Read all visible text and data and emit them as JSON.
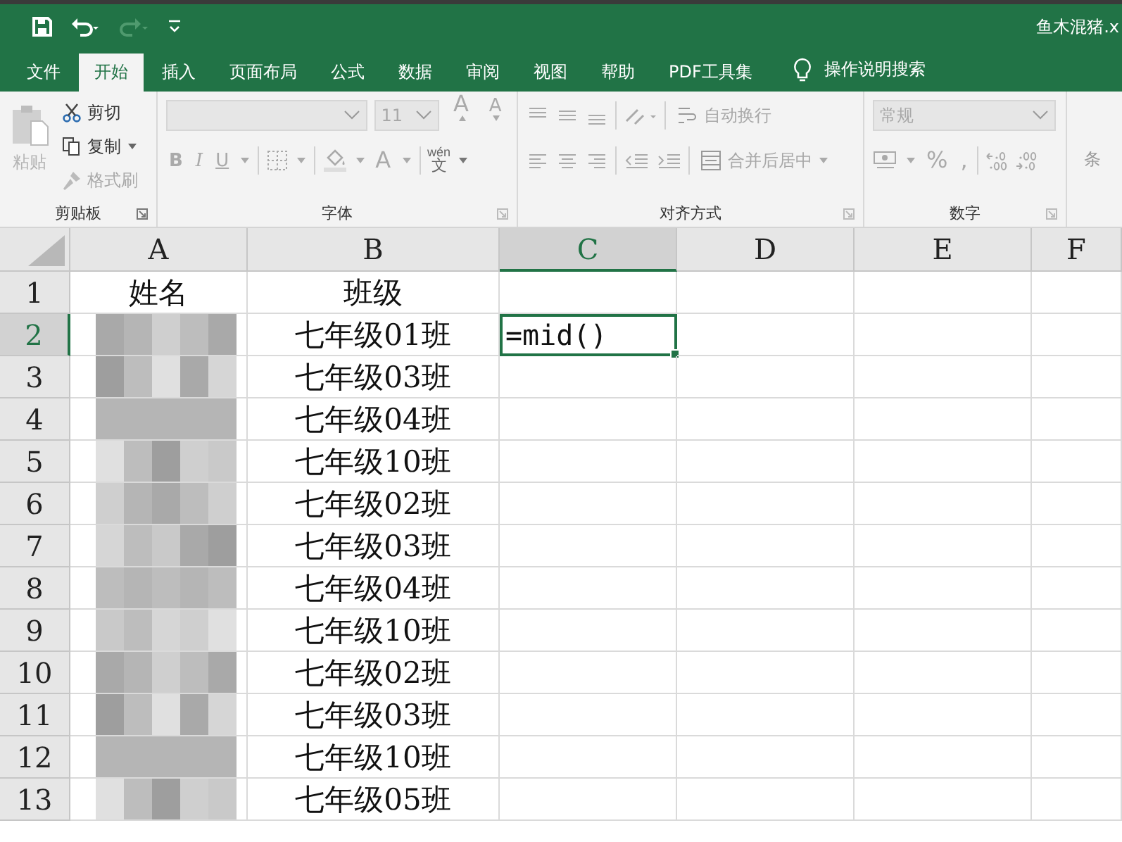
{
  "window": {
    "title": "鱼木混猪.x"
  },
  "tabs": [
    {
      "label": "文件",
      "selected": false
    },
    {
      "label": "开始",
      "selected": true
    },
    {
      "label": "插入",
      "selected": false
    },
    {
      "label": "页面布局",
      "selected": false
    },
    {
      "label": "公式",
      "selected": false
    },
    {
      "label": "数据",
      "selected": false
    },
    {
      "label": "审阅",
      "selected": false
    },
    {
      "label": "视图",
      "selected": false
    },
    {
      "label": "帮助",
      "selected": false
    },
    {
      "label": "PDF工具集",
      "selected": false
    }
  ],
  "tell_me": {
    "placeholder": "操作说明搜索"
  },
  "ribbon": {
    "clipboard": {
      "title": "剪贴板",
      "paste": {
        "label": "粘贴",
        "disabled": true
      },
      "cut": {
        "label": "剪切",
        "disabled": false
      },
      "copy": {
        "label": "复制",
        "disabled": false
      },
      "format_painter": {
        "label": "格式刷",
        "disabled": true
      }
    },
    "font": {
      "title": "字体",
      "font_size": {
        "value": "11"
      },
      "grow": "A",
      "shrink": "A",
      "bold": "B",
      "italic": "I",
      "underline": "U",
      "font_color": "A",
      "phonetic_top": "wén",
      "phonetic_bottom": "文"
    },
    "alignment": {
      "title": "对齐方式",
      "wrap_text": "自动换行",
      "merge_center": "合并后居中"
    },
    "number": {
      "title": "数字",
      "format": {
        "value": "常规"
      },
      "percent": "%",
      "comma": ","
    },
    "cut_off_group_label": "条"
  },
  "sheet": {
    "columns": [
      {
        "label": "A",
        "selected": false
      },
      {
        "label": "B",
        "selected": false
      },
      {
        "label": "C",
        "selected": true
      },
      {
        "label": "D",
        "selected": false
      },
      {
        "label": "E",
        "selected": false
      },
      {
        "label": "F",
        "selected": false
      }
    ],
    "rows": [
      {
        "number": "1",
        "selected": false,
        "name_pixelated": false,
        "name": "姓名",
        "class": "班级"
      },
      {
        "number": "2",
        "selected": true,
        "name_pixelated": true,
        "class": "七年级01班",
        "c": "=mid()"
      },
      {
        "number": "3",
        "selected": false,
        "name_pixelated": true,
        "class": "七年级03班"
      },
      {
        "number": "4",
        "selected": false,
        "name_pixelated": true,
        "class": "七年级04班"
      },
      {
        "number": "5",
        "selected": false,
        "name_pixelated": true,
        "class": "七年级10班"
      },
      {
        "number": "6",
        "selected": false,
        "name_pixelated": true,
        "class": "七年级02班"
      },
      {
        "number": "7",
        "selected": false,
        "name_pixelated": true,
        "class": "七年级03班"
      },
      {
        "number": "8",
        "selected": false,
        "name_pixelated": true,
        "class": "七年级04班"
      },
      {
        "number": "9",
        "selected": false,
        "name_pixelated": true,
        "class": "七年级10班"
      },
      {
        "number": "10",
        "selected": false,
        "name_pixelated": true,
        "class": "七年级02班"
      },
      {
        "number": "11",
        "selected": false,
        "name_pixelated": true,
        "class": "七年级03班"
      },
      {
        "number": "12",
        "selected": false,
        "name_pixelated": true,
        "class": "七年级10班"
      },
      {
        "number": "13",
        "selected": false,
        "name_pixelated": true,
        "class": "七年级05班"
      }
    ]
  }
}
